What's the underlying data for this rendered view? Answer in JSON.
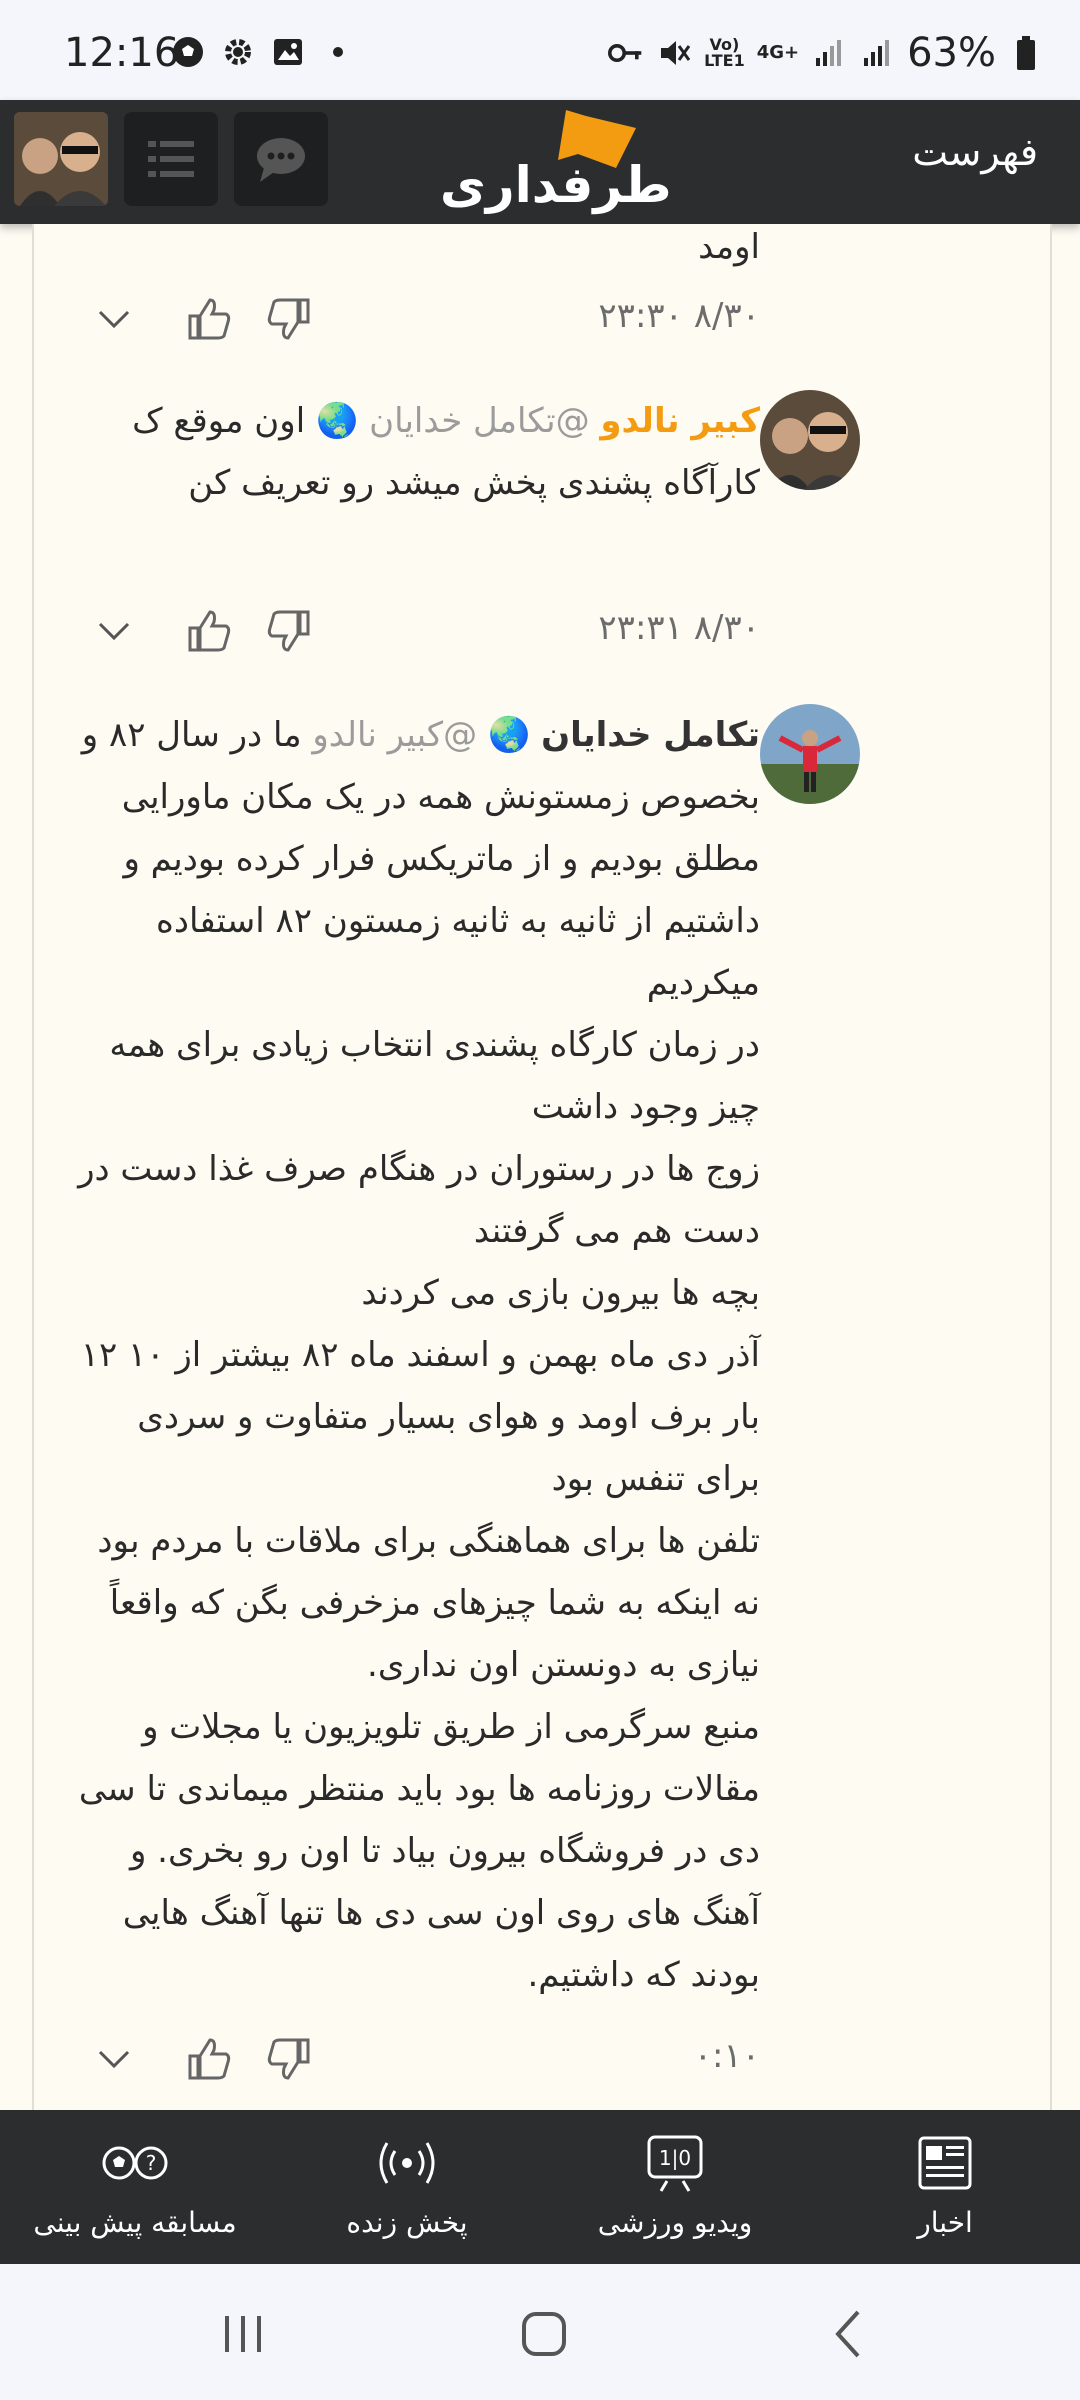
{
  "status_bar": {
    "time": "12:16",
    "battery": "63%",
    "network_label_top": "Vo)",
    "network_label_bottom": "LTE1",
    "network_type": "4G+",
    "icons": [
      "soccer-ball-icon",
      "settings-icon",
      "gallery-icon",
      "dot-icon",
      "key-icon",
      "mute-icon",
      "signal-icon",
      "signal-icon",
      "battery-icon"
    ]
  },
  "app_bar": {
    "menu_label": "فهرست",
    "logo_text": "طرفداری",
    "brand_color": "#f39c12"
  },
  "comments": [
    {
      "partial_text": "اومد",
      "time": "۸/۳۰ ۲۳:۳۰"
    },
    {
      "author": "کبیر نالدو",
      "mention": "@تکامل خدایان",
      "flag": "🌏",
      "text": "اون موقع ک کارآگاه پشندی پخش میشد رو تعریف کن",
      "time": "۸/۳۰ ۲۳:۳۱"
    },
    {
      "author": "تکامل خدایان",
      "mention": "@کبیر نالدو",
      "flag": "🌏",
      "text_lines": [
        "ما در سال ۸۲ و بخصوص زمستونش همه در یک مکان ماورایی مطلق بودیم و از ماتریکس فرار کرده بودیم و داشتیم از ثانیه به ثانیه زمستون ۸۲ استفاده میکردیم",
        "در زمان کارگاه پشندی انتخاب زیادی برای همه چیز وجود داشت",
        "زوج ها در رستوران در هنگام صرف غذا دست در دست هم می گرفتند",
        "بچه ها بیرون بازی می کردند",
        "آذر دی ماه بهمن و اسفند ماه ۸۲ بیشتر از ۱۰ ۱۲ بار برف اومد و هوای بسیار متفاوت و سردی برای تنفس بود",
        "تلفن ها برای هماهنگی برای ملاقات با مردم بود نه اینکه به شما چیزهای مزخرفی بگن که واقعاً نیازی به دونستن اون نداری.",
        "منبع سرگرمی از طریق تلویزیون یا مجلات و مقالات روزنامه ها بود باید منتظر میماندی تا سی دی در فروشگاه بیرون بیاد تا اون رو بخری. و آهنگ های روی اون سی دی ها تنها آهنگ هایی بودند که داشتیم."
      ],
      "time": "۰:۱۰"
    }
  ],
  "bottom_nav": [
    {
      "label": "اخبار",
      "icon": "news-icon"
    },
    {
      "label": "ویدیو ورزشی",
      "icon": "sports-video-icon"
    },
    {
      "label": "پخش زنده",
      "icon": "live-broadcast-icon"
    },
    {
      "label": "مسابقه پیش بینی",
      "icon": "prediction-icon"
    }
  ]
}
